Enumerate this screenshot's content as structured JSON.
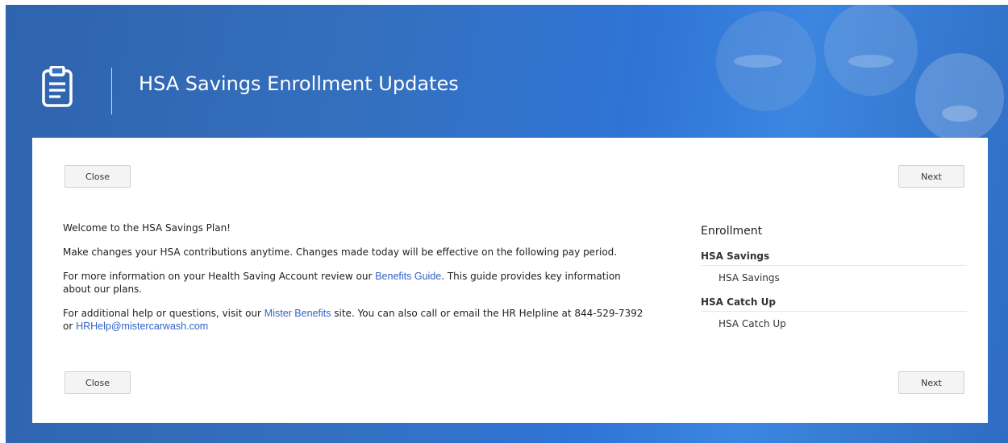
{
  "header": {
    "title": "HSA Savings Enrollment Updates",
    "icon": "clipboard-icon"
  },
  "buttons": {
    "close_label": "Close",
    "next_label": "Next"
  },
  "content": {
    "welcome": "Welcome to the HSA Savings Plan!",
    "changes": "Make changes your HSA contributions anytime. Changes made today will be effective on the following pay period.",
    "info_prefix": "For more information on your Health Saving Account review our ",
    "info_link": "Benefits Guide",
    "info_suffix": ".  This guide provides key information about our plans.",
    "help_prefix": "For additional help or questions, visit our ",
    "help_link": "Mister Benefits",
    "help_middle": " site.  You can also call or email the HR Helpline at 844-529-7392 or ",
    "help_email": "HRHelp@mistercarwash.com"
  },
  "enrollment": {
    "title": "Enrollment",
    "groups": [
      {
        "title": "HSA Savings",
        "items": [
          "HSA Savings"
        ]
      },
      {
        "title": "HSA Catch Up",
        "items": [
          "HSA Catch Up"
        ]
      }
    ]
  },
  "colors": {
    "header_bg": "#3470bf",
    "link": "#2f63c6",
    "panel_bg": "#ffffff"
  }
}
